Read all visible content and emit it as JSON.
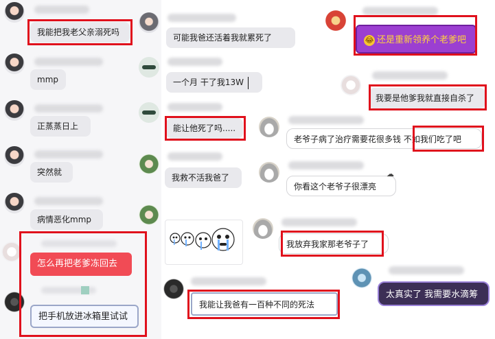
{
  "chat": {
    "col1": [
      {
        "text": "我能把我老父亲溺死吗"
      },
      {
        "text": "mmp"
      },
      {
        "text": "正蒸蒸日上"
      },
      {
        "text": "突然就"
      },
      {
        "text": "病情恶化mmp"
      },
      {
        "text": "怎么再把老爹冻回去"
      },
      {
        "text": "把手机放进冰箱里试试"
      }
    ],
    "col2": [
      {
        "text": "可能我爸还活着我就累死了"
      },
      {
        "text": "一个月 干了我13W"
      },
      {
        "text": "能让他死了吗....."
      },
      {
        "text": "我救不活我爸了"
      },
      {
        "text": "我能让我爸有一百种不同的死法"
      }
    ],
    "col3": [
      {
        "text": "还是重新领养个老爹吧"
      },
      {
        "text": "我要是他爹我就直接自杀了"
      },
      {
        "text": "老爷子病了治疗需要花很多钱 不如我们吃了吧"
      },
      {
        "text": "你看这个老爷子很漂亮"
      },
      {
        "text": "我放弃我家那老爷子了"
      },
      {
        "text": "太真实了 我需要水滴筹"
      }
    ]
  },
  "icons": {
    "emoji": "laughing-tears-emoji-icon",
    "sticker": "crying-panda-meme-sticker"
  },
  "colors": {
    "highlight_border": "#e0101c",
    "bubble_gray": "#e9e9ed",
    "purple_bubble": "#9b3fd1",
    "red_bubble": "#f14b55",
    "dark_bubble": "#3c2f56"
  }
}
